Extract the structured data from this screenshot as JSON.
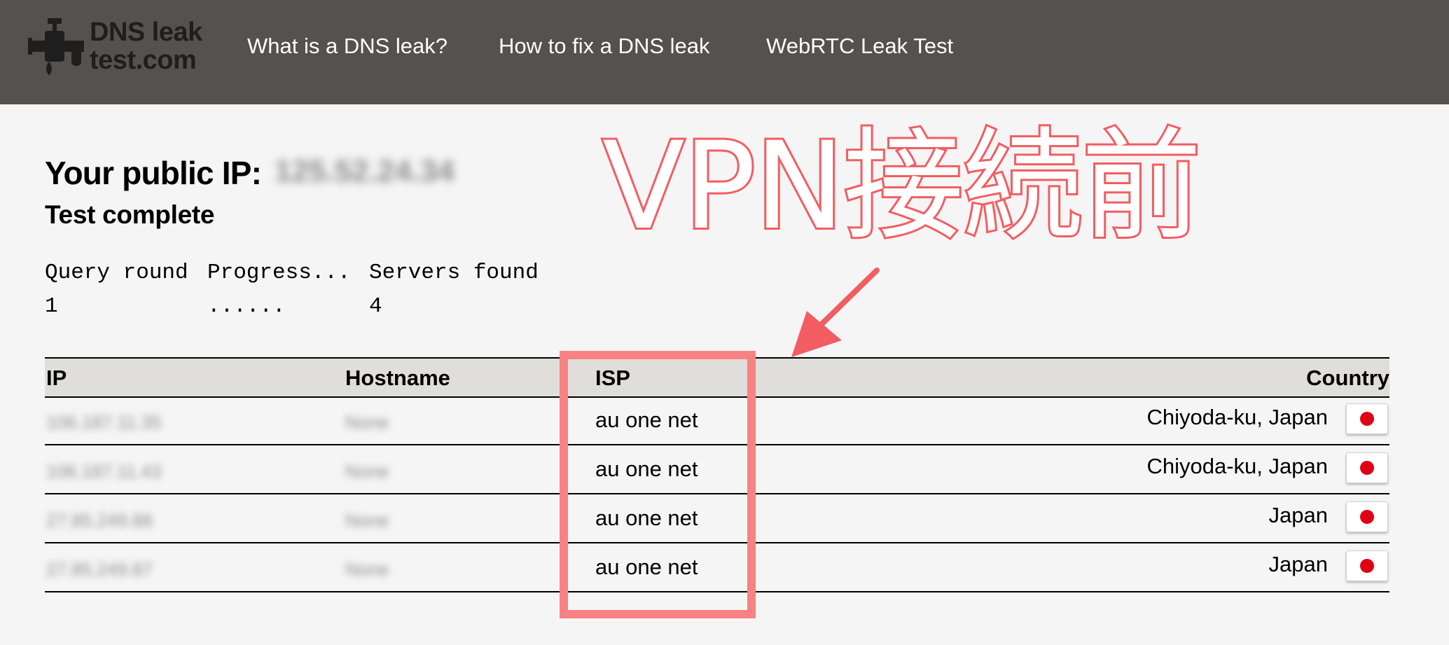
{
  "header": {
    "logo_line1": "DNS leak",
    "logo_line2": "test.com",
    "nav": [
      "What is a DNS leak?",
      "How to fix a DNS leak",
      "WebRTC Leak Test"
    ]
  },
  "main": {
    "public_ip_label": "Your public IP:",
    "public_ip_value": "125.52.24.34",
    "status": "Test complete",
    "progress": {
      "headers": [
        "Query round",
        "Progress...",
        "Servers found"
      ],
      "values": [
        "1",
        "......",
        "4"
      ]
    }
  },
  "annotation": {
    "title": "VPN接続前",
    "colors": {
      "stroke": "#f25d62",
      "box": "#f88283"
    }
  },
  "table": {
    "headers": {
      "ip": "IP",
      "hostname": "Hostname",
      "isp": "ISP",
      "country": "Country"
    },
    "rows": [
      {
        "ip": "106.187.11.35",
        "hostname": "None",
        "isp": "au one net",
        "country": "Chiyoda-ku, Japan",
        "flag": "japan-flag-icon"
      },
      {
        "ip": "106.187.11.43",
        "hostname": "None",
        "isp": "au one net",
        "country": "Chiyoda-ku, Japan",
        "flag": "japan-flag-icon"
      },
      {
        "ip": "27.85.249.88",
        "hostname": "None",
        "isp": "au one net",
        "country": "Japan",
        "flag": "japan-flag-icon"
      },
      {
        "ip": "27.85.249.87",
        "hostname": "None",
        "isp": "au one net",
        "country": "Japan",
        "flag": "japan-flag-icon"
      }
    ]
  }
}
